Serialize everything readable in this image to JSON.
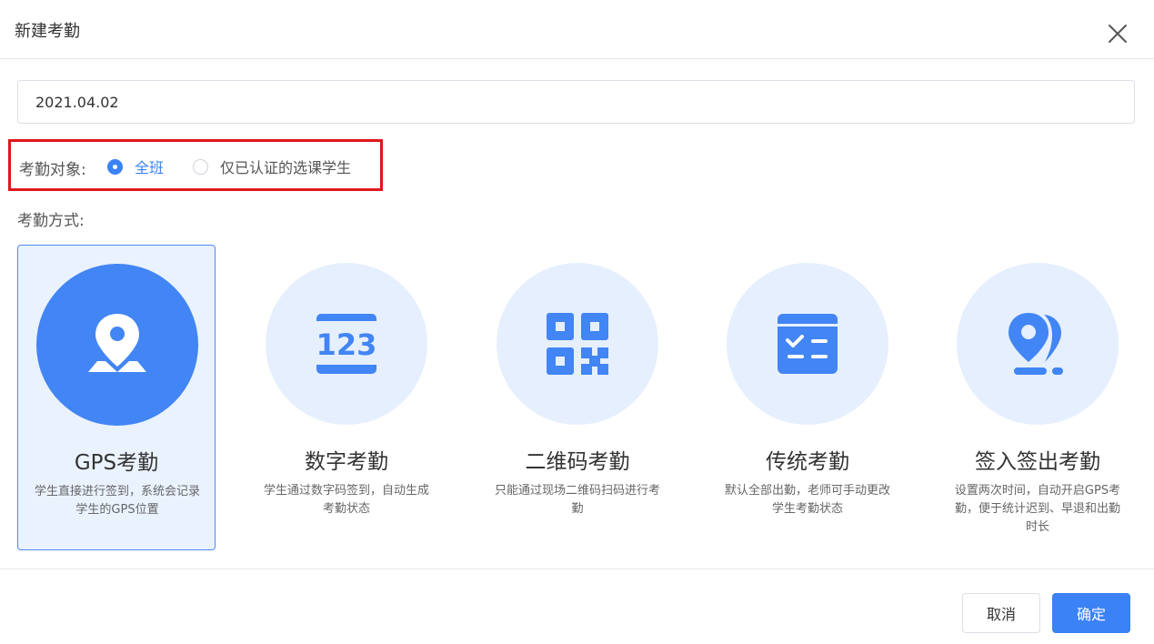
{
  "dialog": {
    "title": "新建考勤",
    "close_icon": "close-icon"
  },
  "date_input": {
    "value": "2021.04.02"
  },
  "target": {
    "label": "考勤对象:",
    "options": [
      {
        "label": "全班",
        "checked": true
      },
      {
        "label": "仅已认证的选课学生",
        "checked": false
      }
    ]
  },
  "method": {
    "label": "考勤方式:",
    "cards": [
      {
        "name": "GPS考勤",
        "desc": "学生直接进行签到，系统会记录学生的GPS位置",
        "icon": "location-pin-icon",
        "selected": true
      },
      {
        "name": "数字考勤",
        "desc": "学生通过数字码签到，自动生成考勤状态",
        "icon": "number-code-icon",
        "selected": false
      },
      {
        "name": "二维码考勤",
        "desc": "只能通过现场二维码扫码进行考勤",
        "icon": "qr-code-icon",
        "selected": false
      },
      {
        "name": "传统考勤",
        "desc": "默认全部出勤，老师可手动更改学生考勤状态",
        "icon": "checklist-icon",
        "selected": false
      },
      {
        "name": "签入签出考勤",
        "desc": "设置两次时间，自动开启GPS考勤，便于统计迟到、早退和出勤时长",
        "icon": "dual-pin-icon",
        "selected": false
      }
    ]
  },
  "footer": {
    "cancel_label": "取消",
    "ok_label": "确定"
  },
  "colors": {
    "accent": "#3b82f6",
    "highlight_border": "#e1161d",
    "card_selected_bg": "#eaf2fe",
    "icon_circle_bg": "#e6effd"
  }
}
